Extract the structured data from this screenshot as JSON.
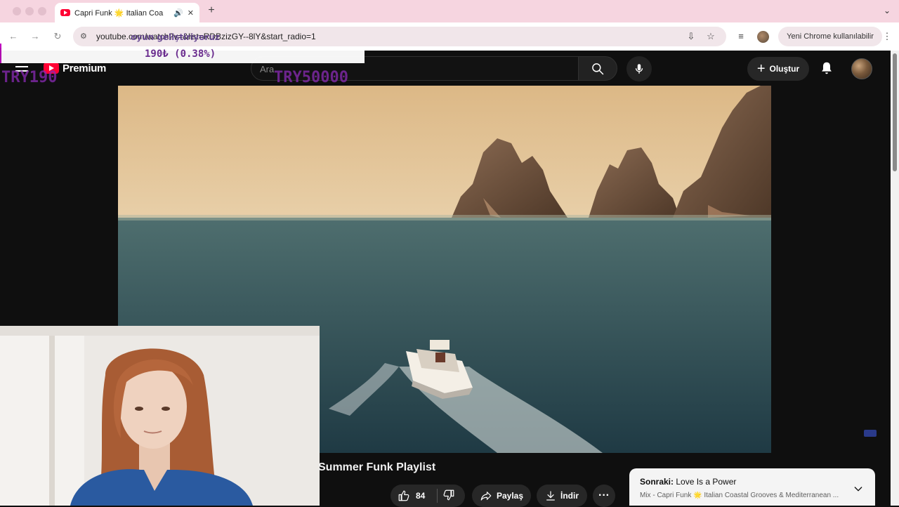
{
  "browser": {
    "tab_title": "Capri Funk 🌟 Italian Coa",
    "new_tab_label": "+",
    "url": "youtube.com/watch?v=&list=RDBzizGY--8lY&start_radio=1",
    "notice": "Yeni Chrome kullanılabilir"
  },
  "overlay": {
    "top_text": "oyun geliştiriyoruz",
    "amount": "190₺ (0.38%)",
    "try_left": "TRY190",
    "try_right": "TRY50000"
  },
  "youtube": {
    "brand": "Premium",
    "search_placeholder": "Ara",
    "create_label": "Oluştur"
  },
  "video": {
    "title": "Summer Funk Playlist",
    "likes": "84",
    "share_label": "Paylaş",
    "download_label": "İndir",
    "more_label": "···"
  },
  "up_next": {
    "prefix": "Sonraki:",
    "title": " Love Is a Power",
    "subtitle": "Mix - Capri Funk 🌟 Italian Coastal Grooves & Mediterranean ..."
  },
  "colors": {
    "tab_strip": "#f6d5e0",
    "youtube_bg": "#0f0f0f",
    "overlay_purple": "#8a2ab5",
    "youtube_red": "#ff0033"
  },
  "icons": [
    "back-icon",
    "forward-icon",
    "reload-icon",
    "site-info-icon",
    "install-icon",
    "star-icon",
    "reading-list-icon",
    "menu-icon",
    "search-icon",
    "mic-icon",
    "bell-icon",
    "like-icon",
    "dislike-icon",
    "share-icon",
    "download-icon",
    "chevron-down-icon"
  ]
}
